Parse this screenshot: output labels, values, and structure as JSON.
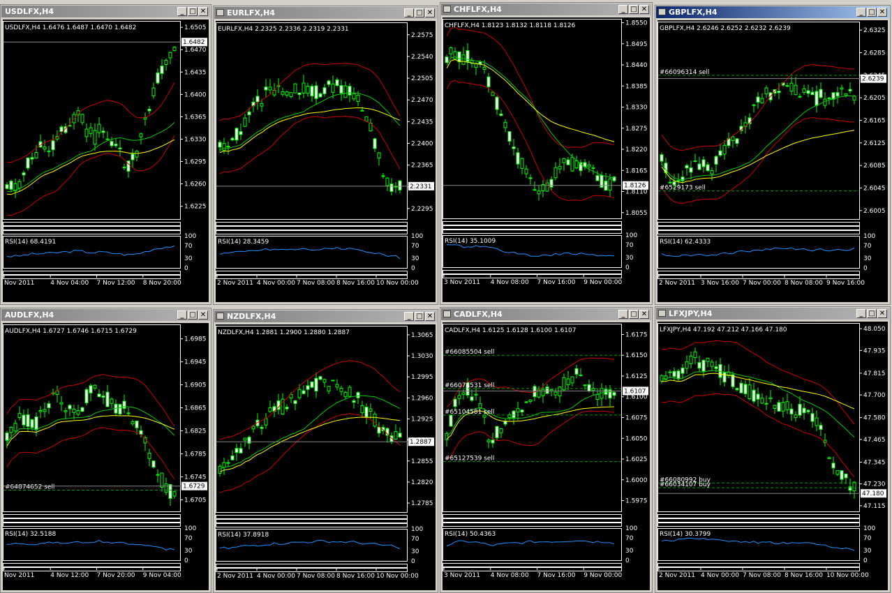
{
  "windows": [
    {
      "title": "USDLFX,H4",
      "active": false,
      "show_icon": false,
      "header": "USDLFX,H4  1.6476 1.6487 1.6470 1.6482",
      "price_ticks": [
        "1.6505",
        "1.6470",
        "1.6435",
        "1.6400",
        "1.6365",
        "1.6330",
        "1.6295",
        "1.6260",
        "1.6225"
      ],
      "price_range": [
        1.6205,
        1.6515
      ],
      "current_price": "1.6482",
      "rsi_label": "RSI(14) 68.4191",
      "rsi_value": 68.4191,
      "rsi_levels": [
        "100",
        "70",
        "30",
        "0"
      ],
      "time_labels": [
        "Nov 2011",
        "4 Nov 04:00",
        "7 Nov 12:00",
        "8 Nov 20:00"
      ],
      "orders": []
    },
    {
      "title": "EURLFX,H4",
      "active": false,
      "show_icon": true,
      "header": "EURLFX,H4  2.2325 2.2336 2.2319 2.2331",
      "price_ticks": [
        "2.2575",
        "2.2540",
        "2.2505",
        "2.2470",
        "2.2435",
        "2.2400",
        "2.2365",
        "2.2330",
        "2.2295"
      ],
      "price_range": [
        2.2278,
        2.2595
      ],
      "current_price": "2.2331",
      "rsi_label": "RSI(14) 28.3459",
      "rsi_value": 28.3459,
      "rsi_levels": [
        "100",
        "70",
        "30",
        "0"
      ],
      "time_labels": [
        "2 Nov 2011",
        "4 Nov 00:00",
        "7 Nov 08:00",
        "8 Nov 16:00",
        "10 Nov 00:00"
      ],
      "orders": []
    },
    {
      "title": "CHFLFX,H4",
      "active": false,
      "show_icon": true,
      "header": "CHFLFX,H4  1.8123 1.8132 1.8118 1.8126",
      "price_ticks": [
        "1.8550",
        "1.8495",
        "1.8440",
        "1.8385",
        "1.8330",
        "1.8275",
        "1.8220",
        "1.8165",
        "1.8110",
        "1.8055"
      ],
      "price_range": [
        1.804,
        1.856
      ],
      "current_price": "1.8126",
      "rsi_label": "RSI(14) 35.1009",
      "rsi_value": 35.1009,
      "rsi_levels": [
        "100",
        "70",
        "30",
        "0"
      ],
      "time_labels": [
        "3 Nov 2011",
        "4 Nov 08:00",
        "7 Nov 16:00",
        "9 Nov 00:00"
      ],
      "orders": []
    },
    {
      "title": "GBPLFX,H4",
      "active": true,
      "show_icon": true,
      "header": "GBPLFX,H4  2.6246 2.6252 2.6232 2.6239",
      "price_ticks": [
        "2.6325",
        "2.6285",
        "2.6245",
        "2.6205",
        "2.6165",
        "2.6125",
        "2.6085",
        "2.6045",
        "2.6005"
      ],
      "price_range": [
        2.599,
        2.634
      ],
      "current_price": "2.6239",
      "rsi_label": "RSI(14) 62.4333",
      "rsi_value": 62.4333,
      "rsi_levels": [
        "100",
        "70",
        "30",
        "0"
      ],
      "time_labels": [
        "2 Nov 2011",
        "3 Nov 16:00",
        "7 Nov 00:00",
        "8 Nov 08:00",
        "9 Nov 16:00"
      ],
      "orders": [
        {
          "label": "#66096314 sell",
          "price": 2.6245
        },
        {
          "label": "#6529173 sell",
          "price": 2.604
        }
      ]
    },
    {
      "title": "AUDLFX,H4",
      "active": false,
      "show_icon": false,
      "header": "AUDLFX,H4  1.6727 1.6746 1.6715 1.6729",
      "price_ticks": [
        "1.6985",
        "1.6945",
        "1.6905",
        "1.6865",
        "1.6825",
        "1.6785",
        "1.6745",
        "1.6705"
      ],
      "price_range": [
        1.6685,
        1.701
      ],
      "current_price": "1.6729",
      "rsi_label": "RSI(14) 32.5188",
      "rsi_value": 32.5188,
      "rsi_levels": [
        "100",
        "70",
        "30",
        "0"
      ],
      "time_labels": [
        "Nov 2011",
        "4 Nov 12:00",
        "7 Nov 20:00",
        "9 Nov 04:00"
      ],
      "orders": [
        {
          "label": "#64874652 sell",
          "price": 1.6722
        }
      ]
    },
    {
      "title": "NZDLFX,H4",
      "active": false,
      "show_icon": true,
      "header": "NZDLFX,H4  1.2881 1.2900 1.2880 1.2887",
      "price_ticks": [
        "1.3065",
        "1.3030",
        "1.2995",
        "1.2960",
        "1.2925",
        "1.2890",
        "1.2855",
        "1.2820",
        "1.2785"
      ],
      "price_range": [
        1.277,
        1.308
      ],
      "current_price": "1.2887",
      "rsi_label": "RSI(14) 37.8918",
      "rsi_value": 37.8918,
      "rsi_levels": [
        "100",
        "70",
        "30",
        "0"
      ],
      "time_labels": [
        "2 Nov 2011",
        "4 Nov 00:00",
        "7 Nov 08:00",
        "8 Nov 16:00",
        "10 Nov 00:00"
      ],
      "orders": []
    },
    {
      "title": "CADLFX,H4",
      "active": false,
      "show_icon": true,
      "header": "CADLFX,H4  1.6125 1.6128 1.6100 1.6107",
      "price_ticks": [
        "1.6175",
        "1.6150",
        "1.6125",
        "1.6100",
        "1.6075",
        "1.6050",
        "1.6025",
        "1.6000",
        "1.5975"
      ],
      "price_range": [
        1.5962,
        1.6188
      ],
      "current_price": "1.6107",
      "rsi_label": "RSI(14) 50.4363",
      "rsi_value": 50.4363,
      "rsi_levels": [
        "100",
        "70",
        "30",
        "0"
      ],
      "time_labels": [
        "3 Nov 2011",
        "4 Nov 08:00",
        "7 Nov 16:00",
        "9 Nov 00:00"
      ],
      "orders": [
        {
          "label": "#66085504 sell",
          "price": 1.615
        },
        {
          "label": "#66074531 sell",
          "price": 1.611
        },
        {
          "label": "#65104581 sell",
          "price": 1.6078
        },
        {
          "label": "#65127539 sell",
          "price": 1.6022
        }
      ]
    },
    {
      "title": "LFXJPY,H4",
      "active": false,
      "show_icon": true,
      "header": "LFXJPY,H4  47.192 47.212 47.166 47.180",
      "price_ticks": [
        "48.050",
        "47.935",
        "47.815",
        "47.700",
        "47.580",
        "47.465",
        "47.345",
        "47.230",
        "47.115"
      ],
      "price_range": [
        47.085,
        48.08
      ],
      "current_price": "47.180",
      "rsi_label": "RSI(14) 30.3799",
      "rsi_value": 30.3799,
      "rsi_levels": [
        "100",
        "70",
        "30",
        "0"
      ],
      "time_labels": [
        "2 Nov 2011",
        "4 Nov 00:00",
        "7 Nov 08:00",
        "8 Nov 16:00",
        "10 Nov 00:00"
      ],
      "orders": [
        {
          "label": "#66080992 buy",
          "price": 47.235
        },
        {
          "label": "#66034107 buy",
          "price": 47.21
        }
      ]
    }
  ],
  "colors": {
    "bg": "#000000",
    "candle": "#00ff00",
    "upper_band": "#cc0000",
    "ma_slow": "#ffff00",
    "ma_mid": "#00cc00",
    "rsi": "#1e90ff",
    "order": "#00a000",
    "grid": "#ffffff"
  }
}
